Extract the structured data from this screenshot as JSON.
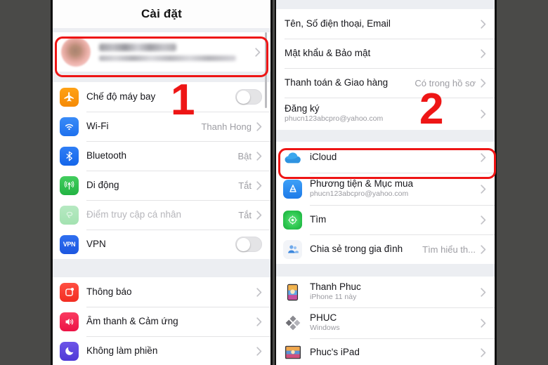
{
  "header": {
    "title": "Cài đặt"
  },
  "left_panel": {
    "profile": {
      "name_redacted": "",
      "sub_redacted": "",
      "chevron": "chevron-right-icon"
    },
    "groups": [
      {
        "rows": [
          {
            "label": "Chế độ máy bay",
            "icon": "airplane-icon",
            "control": "toggle",
            "toggle_on": false
          },
          {
            "label": "Wi-Fi",
            "icon": "wifi-icon",
            "value": "Thanh Hong",
            "control": "chevron"
          },
          {
            "label": "Bluetooth",
            "icon": "bluetooth-icon",
            "value": "Bật",
            "control": "chevron"
          },
          {
            "label": "Di động",
            "icon": "cellular-icon",
            "value": "Tắt",
            "control": "chevron"
          },
          {
            "label": "Điểm truy cập cá nhân",
            "icon": "hotspot-icon",
            "value": "Tắt",
            "control": "chevron",
            "dim": true
          },
          {
            "label": "VPN",
            "icon": "vpn-icon",
            "control": "toggle",
            "toggle_on": false
          }
        ]
      },
      {
        "rows": [
          {
            "label": "Thông báo",
            "icon": "notifications-icon",
            "control": "chevron"
          },
          {
            "label": "Âm thanh & Cảm ứng",
            "icon": "sounds-icon",
            "control": "chevron"
          },
          {
            "label": "Không làm phiền",
            "icon": "do-not-disturb-icon",
            "control": "chevron"
          }
        ]
      }
    ]
  },
  "right_panel": {
    "groups": [
      {
        "rows": [
          {
            "label": "Tên, Số điện thoại, Email",
            "control": "chevron"
          },
          {
            "label": "Mật khẩu & Bảo mật",
            "control": "chevron"
          },
          {
            "label": "Thanh toán & Giao hàng",
            "value": "Có trong hồ sơ",
            "control": "chevron"
          },
          {
            "label": "Đăng ký",
            "sublabel": "phucn123abcpro@yahoo.com",
            "control": "chevron"
          }
        ]
      },
      {
        "rows": [
          {
            "label": "iCloud",
            "icon": "icloud-icon",
            "control": "chevron",
            "highlighted": true
          },
          {
            "label": "Phương tiện & Mục mua",
            "sublabel": "phucn123abcpro@yahoo.com",
            "icon": "appstore-icon",
            "control": "chevron"
          },
          {
            "label": "Tìm",
            "icon": "findmy-icon",
            "control": "chevron"
          },
          {
            "label": "Chia sẻ trong gia đình",
            "value": "Tìm hiểu th...",
            "icon": "family-sharing-icon",
            "control": "chevron"
          }
        ]
      },
      {
        "rows": [
          {
            "label": "Thanh Phuc",
            "sublabel": "iPhone 11 này",
            "icon": "iphone-device-icon",
            "control": "chevron"
          },
          {
            "label": "PHUC",
            "sublabel": "Windows",
            "icon": "windows-device-icon",
            "control": "chevron"
          },
          {
            "label": "Phuc's iPad",
            "icon": "ipad-device-icon",
            "control": "chevron"
          }
        ]
      }
    ]
  },
  "annotations": {
    "markers": [
      {
        "text": "1",
        "target": "profile-row"
      },
      {
        "text": "2",
        "target": "icloud-row"
      }
    ],
    "accent_color": "#ee1515"
  }
}
